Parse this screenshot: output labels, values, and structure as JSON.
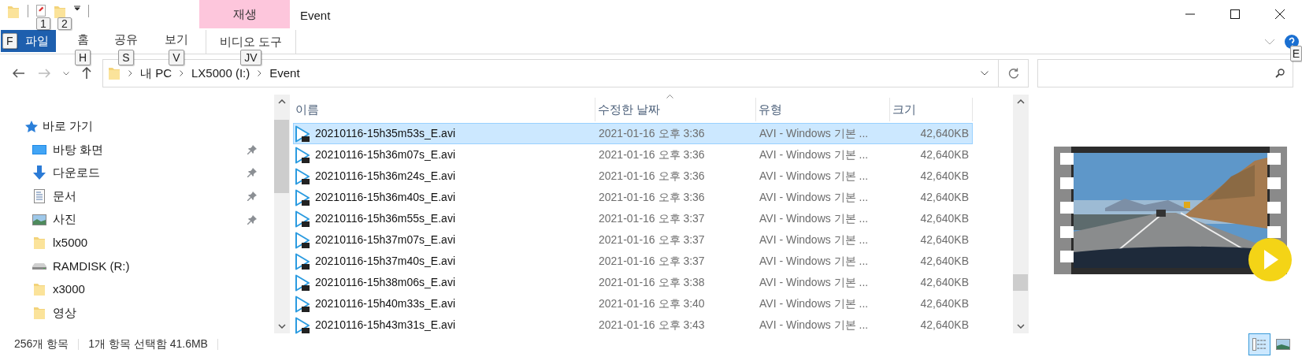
{
  "quick_access_keytips": [
    "1",
    "2"
  ],
  "window": {
    "title": "Event"
  },
  "ribbon_tabs": [
    {
      "label": "파일",
      "keytip": "F",
      "kind": "file"
    },
    {
      "label": "홈",
      "keytip": "H",
      "kind": "tab"
    },
    {
      "label": "공유",
      "keytip": "S",
      "kind": "tab"
    },
    {
      "label": "보기",
      "keytip": "V",
      "kind": "tab"
    },
    {
      "label": "비디오 도구",
      "group": "재생",
      "keytip": "JV",
      "kind": "contextual"
    }
  ],
  "help_keytip": "E",
  "breadcrumb": [
    "내 PC",
    "LX5000 (I:)",
    "Event"
  ],
  "sidebar": {
    "header": "바로 가기",
    "items": [
      {
        "label": "바탕 화면",
        "kind": "desktop",
        "pinned": true
      },
      {
        "label": "다운로드",
        "kind": "download",
        "pinned": true
      },
      {
        "label": "문서",
        "kind": "document",
        "pinned": true
      },
      {
        "label": "사진",
        "pinned": true
      },
      {
        "label": "lx5000",
        "kind": "folder",
        "pinned": false
      },
      {
        "label": "RAMDISK (R:)",
        "kind": "drive",
        "pinned": false
      },
      {
        "label": "x3000",
        "kind": "folder",
        "pinned": false
      },
      {
        "label": "영상",
        "kind": "folder",
        "pinned": false
      }
    ]
  },
  "table": {
    "columns": [
      {
        "label": "이름",
        "sorted": false
      },
      {
        "label": "수정한 날짜",
        "sorted": true
      },
      {
        "label": "유형",
        "sorted": false
      },
      {
        "label": "크기",
        "sorted": false
      }
    ],
    "rows": [
      {
        "name": "20210116-15h35m53s_E.avi",
        "date": "2021-01-16 오후 3:36",
        "type": "AVI - Windows 기본 ...",
        "size": "42,640KB",
        "selected": true
      },
      {
        "name": "20210116-15h36m07s_E.avi",
        "date": "2021-01-16 오후 3:36",
        "type": "AVI - Windows 기본 ...",
        "size": "42,640KB",
        "selected": false
      },
      {
        "name": "20210116-15h36m24s_E.avi",
        "date": "2021-01-16 오후 3:36",
        "type": "AVI - Windows 기본 ...",
        "size": "42,640KB",
        "selected": false
      },
      {
        "name": "20210116-15h36m40s_E.avi",
        "date": "2021-01-16 오후 3:36",
        "type": "AVI - Windows 기본 ...",
        "size": "42,640KB",
        "selected": false
      },
      {
        "name": "20210116-15h36m55s_E.avi",
        "date": "2021-01-16 오후 3:37",
        "type": "AVI - Windows 기본 ...",
        "size": "42,640KB",
        "selected": false
      },
      {
        "name": "20210116-15h37m07s_E.avi",
        "date": "2021-01-16 오후 3:37",
        "type": "AVI - Windows 기본 ...",
        "size": "42,640KB",
        "selected": false
      },
      {
        "name": "20210116-15h37m40s_E.avi",
        "date": "2021-01-16 오후 3:37",
        "type": "AVI - Windows 기본 ...",
        "size": "42,640KB",
        "selected": false
      },
      {
        "name": "20210116-15h38m06s_E.avi",
        "date": "2021-01-16 오후 3:38",
        "type": "AVI - Windows 기본 ...",
        "size": "42,640KB",
        "selected": false
      },
      {
        "name": "20210116-15h40m33s_E.avi",
        "date": "2021-01-16 오후 3:40",
        "type": "AVI - Windows 기본 ...",
        "size": "42,640KB",
        "selected": false
      },
      {
        "name": "20210116-15h43m31s_E.avi",
        "date": "2021-01-16 오후 3:43",
        "type": "AVI - Windows 기본 ...",
        "size": "42,640KB",
        "selected": false
      }
    ]
  },
  "preview": {
    "kind": "picture"
  },
  "status_bar": {
    "count": "256개 항목",
    "selection": "1개 항목 선택함 41.6MB"
  }
}
